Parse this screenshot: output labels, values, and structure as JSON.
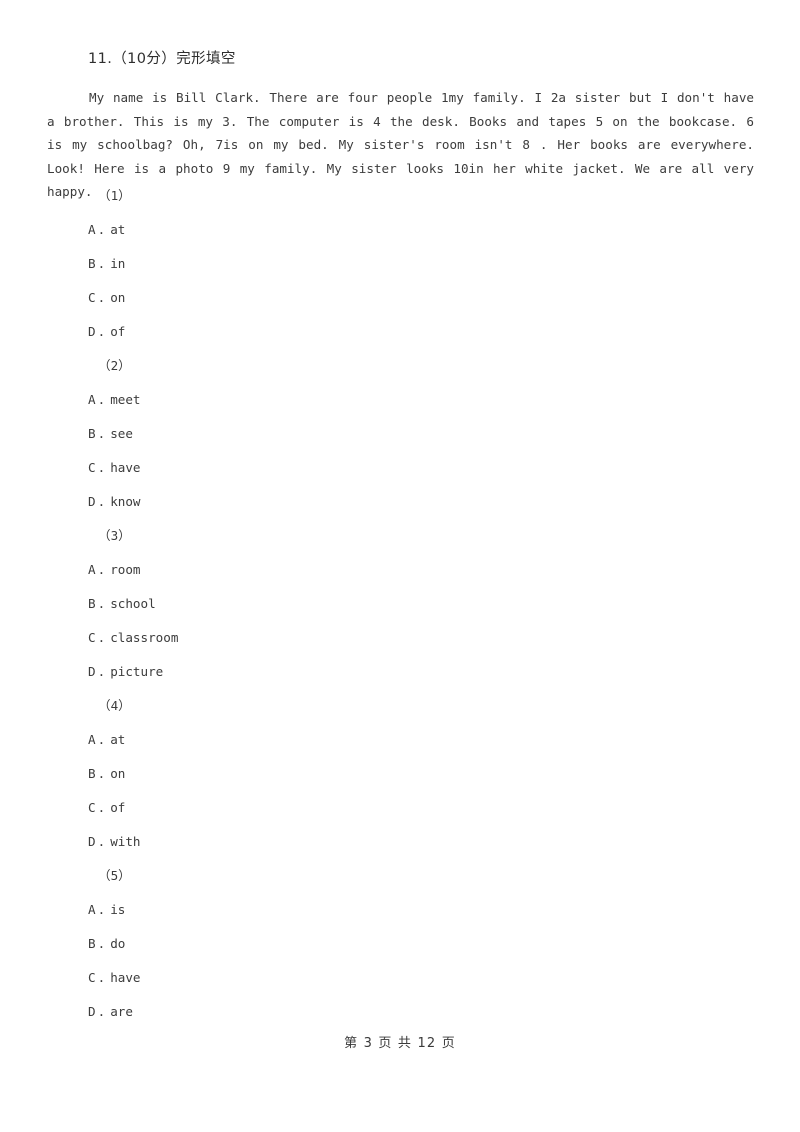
{
  "document": {
    "heading": "11.（10分）完形填空",
    "passage": "My name is Bill Clark. There are four people 1my family. I 2a sister but I don't have a brother. This is my 3. The computer is 4 the desk. Books and tapes 5 on the bookcase. 6 is my schoolbag? Oh, 7is on my bed. My sister's room isn't 8 . Her books are everywhere. Look! Here is a photo 9 my family. My sister looks 10in her white jacket. We are all very happy.",
    "questions": [
      {
        "number": "（1）",
        "options": [
          {
            "letter": "A",
            "sep": ".",
            "text": "at"
          },
          {
            "letter": "B",
            "sep": ".",
            "text": "in"
          },
          {
            "letter": "C",
            "sep": ".",
            "text": "on"
          },
          {
            "letter": "D",
            "sep": ".",
            "text": "of"
          }
        ]
      },
      {
        "number": "（2）",
        "options": [
          {
            "letter": "A",
            "sep": ".",
            "text": "meet"
          },
          {
            "letter": "B",
            "sep": ".",
            "text": "see"
          },
          {
            "letter": "C",
            "sep": ".",
            "text": "have"
          },
          {
            "letter": "D",
            "sep": ".",
            "text": "know"
          }
        ]
      },
      {
        "number": "（3）",
        "options": [
          {
            "letter": "A",
            "sep": ".",
            "text": "room"
          },
          {
            "letter": "B",
            "sep": ".",
            "text": "school"
          },
          {
            "letter": "C",
            "sep": ".",
            "text": "classroom"
          },
          {
            "letter": "D",
            "sep": ".",
            "text": "picture"
          }
        ]
      },
      {
        "number": "（4）",
        "options": [
          {
            "letter": "A",
            "sep": ".",
            "text": "at"
          },
          {
            "letter": "B",
            "sep": ".",
            "text": "on"
          },
          {
            "letter": "C",
            "sep": ".",
            "text": "of"
          },
          {
            "letter": "D",
            "sep": ".",
            "text": "with"
          }
        ]
      },
      {
        "number": "（5）",
        "options": [
          {
            "letter": "A",
            "sep": ".",
            "text": "is"
          },
          {
            "letter": "B",
            "sep": ".",
            "text": "do"
          },
          {
            "letter": "C",
            "sep": ".",
            "text": "have"
          },
          {
            "letter": "D",
            "sep": ".",
            "text": "are"
          }
        ]
      }
    ],
    "footer": "第 3 页 共 12 页"
  }
}
